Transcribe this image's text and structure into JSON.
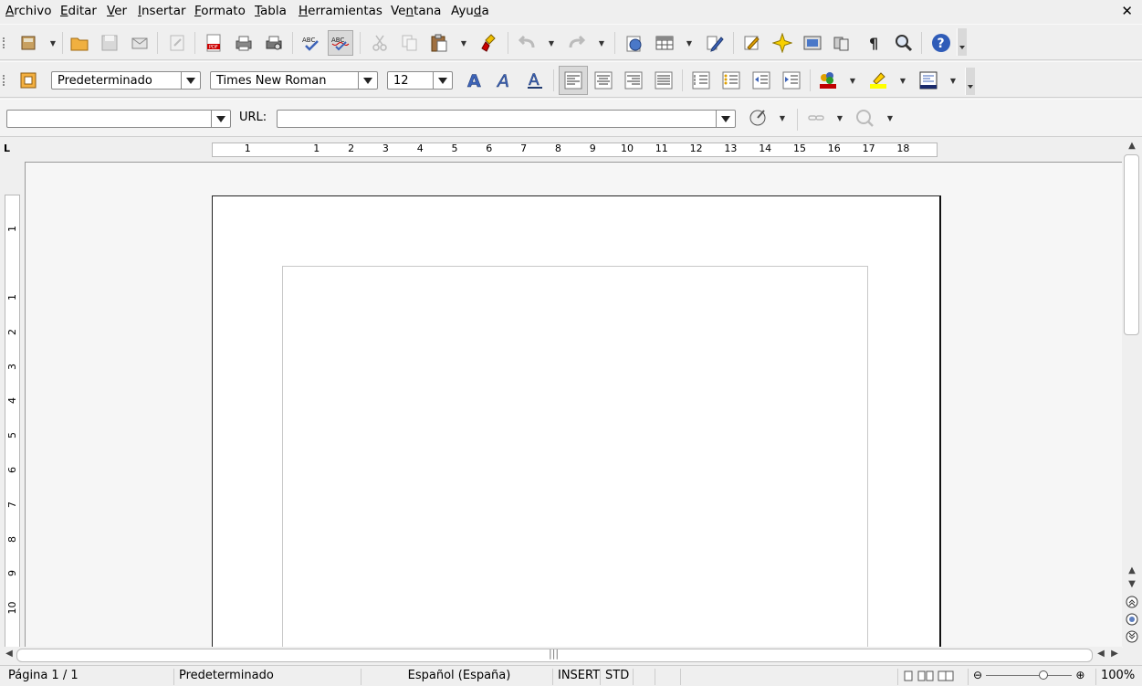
{
  "menubar": {
    "items": [
      {
        "label": "Archivo",
        "mnemonic": "A",
        "rest": "rchivo"
      },
      {
        "label": "Editar",
        "mnemonic": "E",
        "rest": "ditar"
      },
      {
        "label": "Ver",
        "mnemonic": "V",
        "rest": "er"
      },
      {
        "label": "Insertar",
        "mnemonic": "I",
        "rest": "nsertar"
      },
      {
        "label": "Formato",
        "mnemonic": "F",
        "rest": "ormato"
      },
      {
        "label": "Tabla",
        "mnemonic": "T",
        "rest": "abla"
      },
      {
        "label": "Herramientas",
        "mnemonic": "H",
        "rest": "erramientas"
      },
      {
        "label": "Ventana",
        "pre": "Ve",
        "mnemonic": "n",
        "rest": "tana"
      },
      {
        "label": "Ayuda",
        "pre": "Ayu",
        "mnemonic": "d",
        "rest": "a"
      }
    ],
    "close_glyph": "✕"
  },
  "formatting": {
    "paragraph_style": "Predeterminado",
    "font_name": "Times New Roman",
    "font_size": "12"
  },
  "hyperlink_bar": {
    "target_value": "",
    "url_label": "URL:",
    "url_value": ""
  },
  "ruler": {
    "h_labels": [
      "1",
      "1",
      "2",
      "3",
      "4",
      "5",
      "6",
      "7",
      "8",
      "9",
      "10",
      "11",
      "12",
      "13",
      "14",
      "15",
      "16",
      "17",
      "18"
    ],
    "v_labels": [
      "1",
      "1",
      "2",
      "3",
      "4",
      "5",
      "6",
      "7",
      "8",
      "9",
      "10"
    ],
    "corner_glyph": "L"
  },
  "statusbar": {
    "page": "Página  1 / 1",
    "page_style": "Predeterminado",
    "language": "Español (España)",
    "insert_mode": "INSERT",
    "selection_mode": "STD",
    "zoom": "100%"
  },
  "colors": {
    "accent_blue": "#3d63b8",
    "font_color_red": "#c00000",
    "highlight_yellow": "#ffff00"
  }
}
